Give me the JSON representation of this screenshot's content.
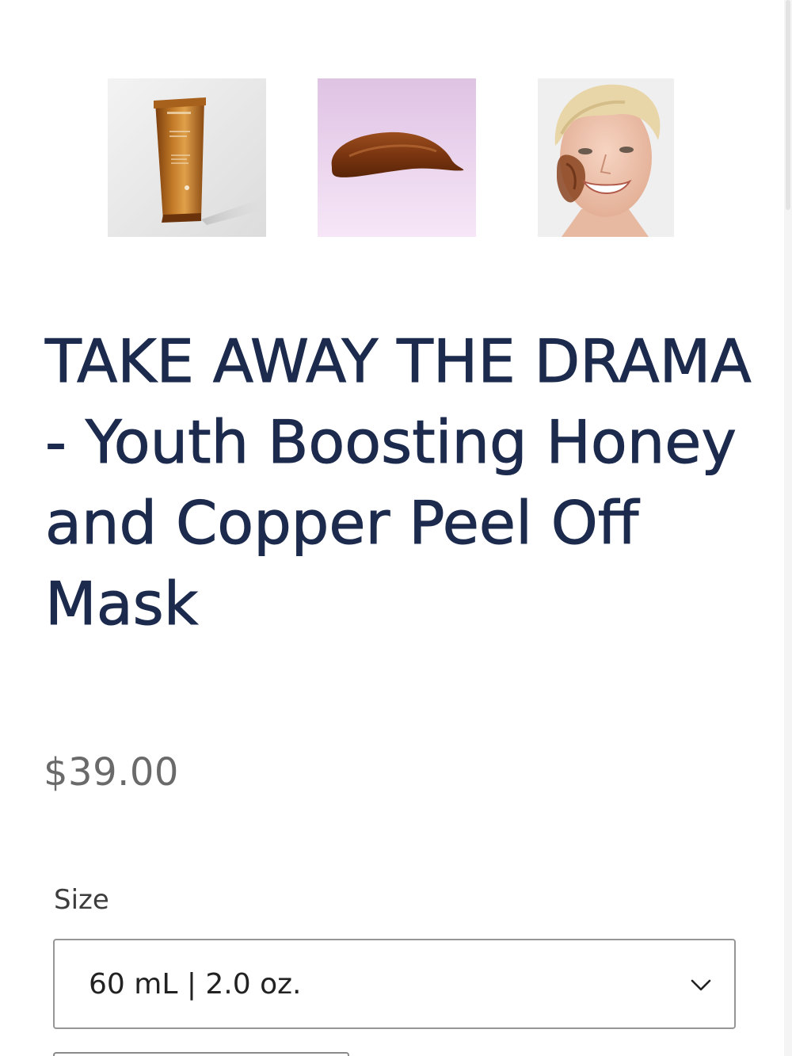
{
  "product": {
    "title": "TAKE AWAY THE DRAMA - Youth Boosting Honey and Copper Peel Off Mask",
    "price": "$39.00"
  },
  "gallery": {
    "thumbnails": [
      {
        "name": "product-tube-thumbnail"
      },
      {
        "name": "product-texture-swatch-thumbnail"
      },
      {
        "name": "model-wearing-mask-thumbnail"
      }
    ]
  },
  "size_selector": {
    "label": "Size",
    "selected": "60 mL | 2.0 oz.",
    "icon": "chevron-down-icon"
  },
  "colors": {
    "title": "#1c2b4d",
    "price": "#6a6a6a",
    "swatch_background": "#e3c9e6"
  }
}
